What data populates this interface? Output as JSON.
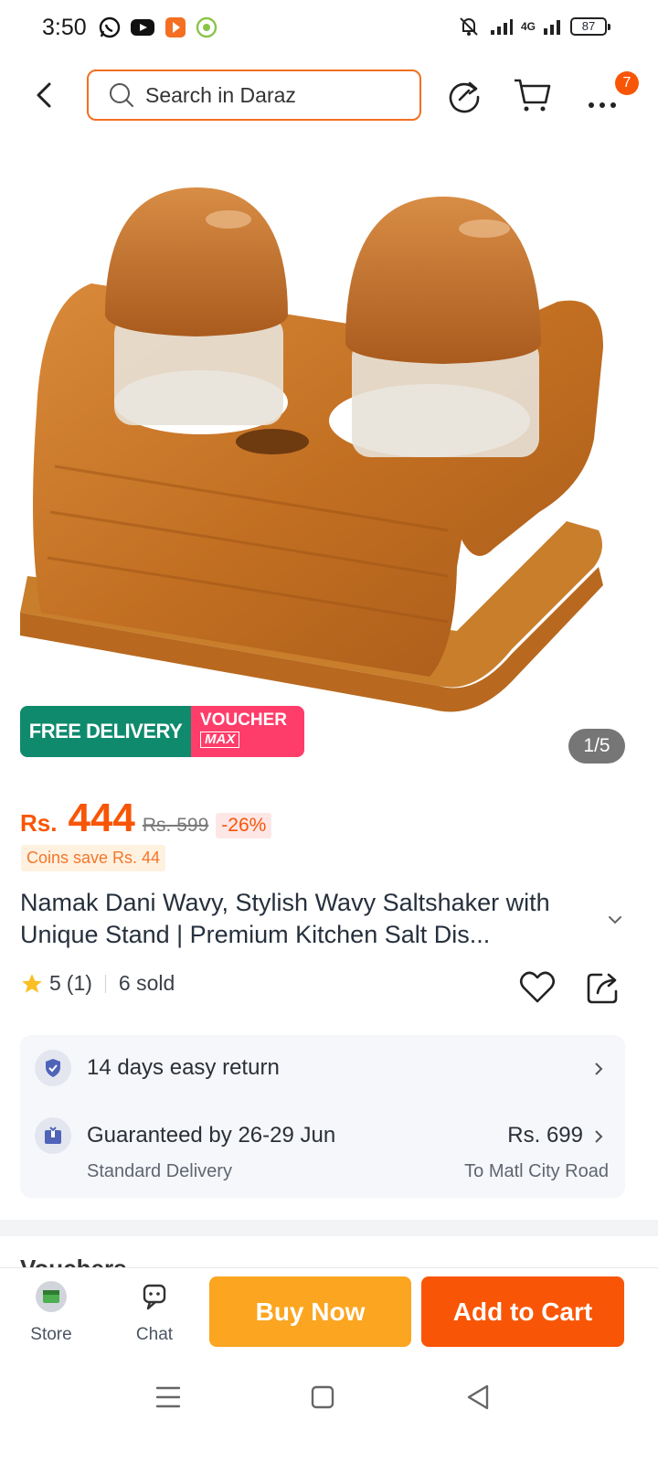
{
  "status_bar": {
    "time": "3:50",
    "network": "4G",
    "battery": "87",
    "app_icons": [
      "whatsapp-icon",
      "youtube-icon",
      "app-icon",
      "circle-app-icon"
    ]
  },
  "header": {
    "search_placeholder": "Search in Daraz",
    "more_badge": "7"
  },
  "gallery": {
    "promo_free": "FREE DELIVERY",
    "promo_voucher": "VOUCHER",
    "promo_voucher_sub": "MAX",
    "counter": "1/5"
  },
  "price": {
    "currency": "Rs.",
    "current": "444",
    "original": "Rs. 599",
    "discount": "-26%",
    "coins": "Coins save Rs. 44"
  },
  "product": {
    "title": "Namak Dani Wavy, Stylish Wavy Saltshaker with Unique Stand | Premium Kitchen Salt Dis...",
    "rating": "5",
    "rating_count": "(1)",
    "sold": "6 sold"
  },
  "service": {
    "return_text": "14 days easy return",
    "delivery_text": "Guaranteed by 26-29 Jun",
    "delivery_type": "Standard Delivery",
    "delivery_price": "Rs. 699",
    "delivery_location": "To Matl City Road"
  },
  "next_section": "Vouchers",
  "action_bar": {
    "store_label": "Store",
    "chat_label": "Chat",
    "buy_now": "Buy Now",
    "add_to_cart": "Add to Cart"
  },
  "colors": {
    "brand_orange": "#f85606",
    "buy_now": "#fca520",
    "free_delivery": "#0f8a6d",
    "voucher": "#ff3d6a"
  }
}
